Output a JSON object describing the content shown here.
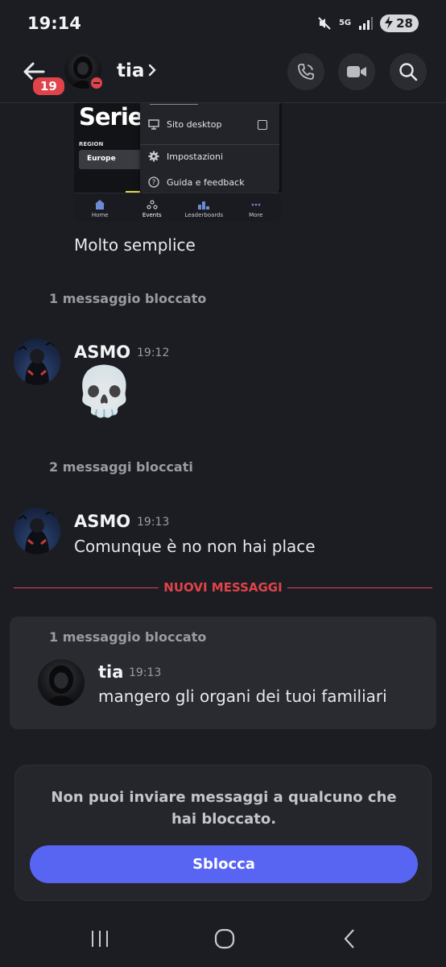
{
  "status_bar": {
    "time": "19:14",
    "network": "5G",
    "battery": "28"
  },
  "header": {
    "unread_badge": "19",
    "contact_name": "tia",
    "icons": [
      "back-arrow-icon",
      "chevron-right-icon",
      "phone-call-icon",
      "video-camera-icon",
      "search-icon"
    ]
  },
  "embed": {
    "title": "Serie",
    "region_label": "REGION",
    "region_value": "Europe",
    "menu_items": [
      {
        "label": "Sito desktop",
        "icon": "desktop-icon"
      },
      {
        "label": "Impostazioni",
        "icon": "gear-icon"
      },
      {
        "label": "Guida e feedback",
        "icon": "help-icon"
      }
    ],
    "tabs": [
      "Home",
      "Events",
      "Leaderboards",
      "More"
    ]
  },
  "messages": {
    "m1_text": "Molto semplice",
    "blocked_1": "1 messaggio bloccato",
    "asmo_1": {
      "author": "ASMO",
      "time": "19:12",
      "content": "💀"
    },
    "blocked_2": "2 messaggi bloccati",
    "asmo_2": {
      "author": "ASMO",
      "time": "19:13",
      "content": "Comunque è no non hai place"
    },
    "new_messages_label": "NUOVI MESSAGGI",
    "blocked_3": "1 messaggio bloccato",
    "tia_1": {
      "author": "tia",
      "time": "19:13",
      "content": "mangero gli organi dei tuoi familiari"
    }
  },
  "blocked_panel": {
    "notice": "Non puoi inviare messaggi a qualcuno che hai bloccato.",
    "button_label": "Sblocca"
  },
  "colors": {
    "background": "#1c1d22",
    "accent": "#5865f2",
    "danger": "#e0434a"
  }
}
